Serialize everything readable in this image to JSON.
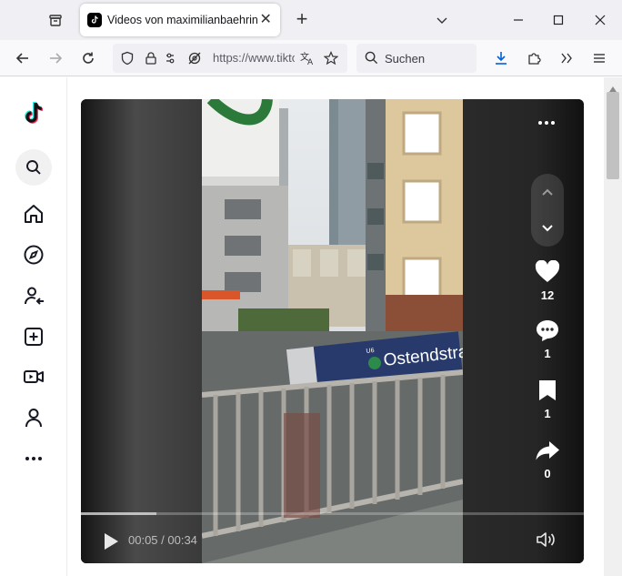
{
  "browser": {
    "tab_title": "Videos von maximilianbaehring",
    "url_text": "https://www.tiktok.com",
    "search_placeholder": "Suchen"
  },
  "sidebar": {
    "items": [
      "tiktok-logo",
      "search",
      "home",
      "explore",
      "following",
      "upload",
      "live",
      "profile",
      "more"
    ]
  },
  "video": {
    "signs": {
      "station": "Ostendstraße",
      "line_badge": "U6"
    },
    "actions": {
      "likes": "12",
      "comments": "1",
      "saves": "1",
      "shares": "0"
    },
    "player": {
      "time": "00:05 / 00:34",
      "progress": 0.15
    }
  },
  "colors": {
    "accent": "#fe2c55",
    "cyan": "#25f4ee",
    "dark": "#121212"
  }
}
